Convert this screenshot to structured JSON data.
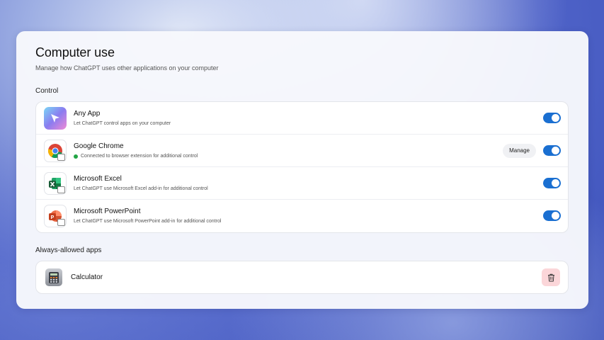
{
  "page": {
    "title": "Computer use",
    "subtitle": "Manage how ChatGPT uses other applications on your computer"
  },
  "control": {
    "label": "Control",
    "items": [
      {
        "title": "Any App",
        "description": "Let ChatGPT control apps on your computer",
        "icon": "any-app-icon",
        "enabled": true
      },
      {
        "title": "Google Chrome",
        "description": "Connected to browser extension for additional control",
        "icon": "chrome-icon",
        "status_color": "#22a545",
        "manage_label": "Manage",
        "enabled": true
      },
      {
        "title": "Microsoft Excel",
        "description": "Let ChatGPT use Microsoft Excel add-in for additional control",
        "icon": "excel-icon",
        "enabled": true
      },
      {
        "title": "Microsoft PowerPoint",
        "description": "Let ChatGPT use Microsoft PowerPoint add-in for additional control",
        "icon": "powerpoint-icon",
        "enabled": true
      }
    ]
  },
  "always_allowed": {
    "label": "Always-allowed apps",
    "items": [
      {
        "title": "Calculator",
        "icon": "calculator-icon",
        "remove_icon": "trash-icon"
      }
    ]
  },
  "colors": {
    "toggle_on": "#1a6fd1",
    "remove_bg": "#fbd6d9"
  }
}
